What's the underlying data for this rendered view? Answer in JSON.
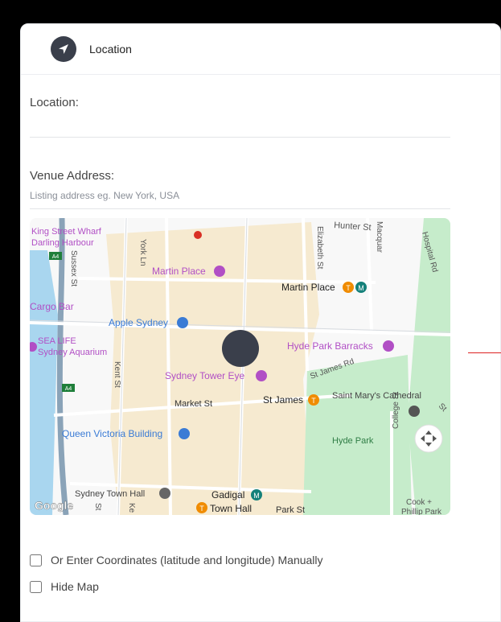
{
  "card": {
    "title": "Location",
    "header_icon": "navigation-arrow-icon"
  },
  "fields": {
    "location": {
      "label": "Location:",
      "value": "",
      "placeholder": ""
    },
    "venue_address": {
      "label": "Venue Address:",
      "value": "",
      "placeholder": "Listing address eg. New York, USA"
    }
  },
  "map": {
    "provider_logo": "Google",
    "streets": {
      "hunter": "Hunter St",
      "hospital": "Hospital Rd",
      "elizabeth": "Elizabeth St",
      "macquarie": "Macquar",
      "york": "York Ln",
      "sussex": "Sussex St",
      "kent": "Kent St",
      "market": "Market St",
      "st_james_rd": "St James Rd",
      "college": "College St",
      "park": "Park St",
      "a4_top": "A4",
      "a4_bottom": "A4",
      "ke": "Ke",
      "st_short": "St",
      "st_right": "St"
    },
    "places": {
      "king_street_wharf": "King Street Wharf",
      "darling_harbour": "Darling Harbour",
      "cargo_bar": "Cargo Bar",
      "martin_place_plaza": "Martin Place",
      "martin_place_station": "Martin Place",
      "apple_sydney": "Apple Sydney",
      "sea_life": "SEA LIFE",
      "sydney_aquarium": "Sydney Aquarium",
      "hyde_park_barracks": "Hyde Park Barracks",
      "sydney_tower_eye": "Sydney Tower Eye",
      "st_james": "St James",
      "saint_marys": "Saint Mary's Cathedral",
      "qvb": "Queen Victoria Building",
      "hyde_park": "Hyde Park",
      "sydney_town_hall": "Sydney Town Hall",
      "gadigal": "Gadigal",
      "town_hall": "Town Hall",
      "cook_phillip_1": "Cook +",
      "cook_phillip_2": "Phillip Park"
    },
    "badges": {
      "train": "T",
      "metro": "M"
    },
    "colors": {
      "land": "#f8f8f8",
      "cbd": "#f6ead0",
      "park": "#c6eccb",
      "water": "#a9d6ef",
      "motorway": "#8aa3b8",
      "label_blue": "#3a7bd5",
      "label_pink": "#b14fc5",
      "train_orange": "#f08c00",
      "metro_teal": "#15817a"
    }
  },
  "options": {
    "manual_coordinates": {
      "label": "Or Enter Coordinates (latitude and longitude) Manually",
      "checked": false
    },
    "hide_map": {
      "label": "Hide Map",
      "checked": false
    }
  }
}
